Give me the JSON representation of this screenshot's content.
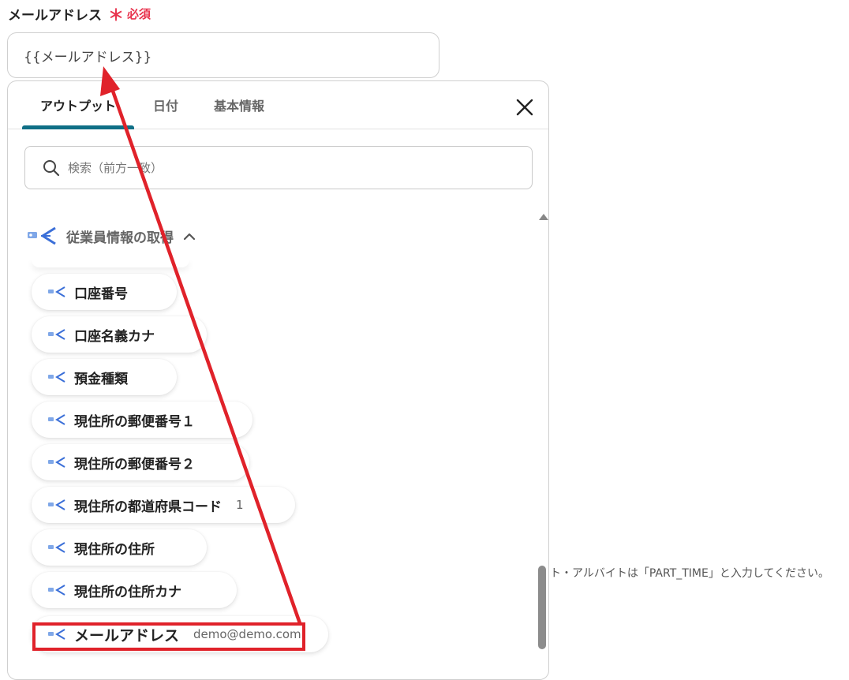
{
  "field": {
    "label": "メールアドレス",
    "required_star": "＊",
    "required_text": "必須",
    "value": "{{メールアドレス}}"
  },
  "panel": {
    "tabs": [
      {
        "label": "アウトプット",
        "active": true
      },
      {
        "label": "日付",
        "active": false
      },
      {
        "label": "基本情報",
        "active": false
      }
    ],
    "search_placeholder": "検索（前方一致）",
    "group_title": "従業員情報の取得",
    "items": [
      {
        "label": "口座番号",
        "sample": ""
      },
      {
        "label": "口座名義カナ",
        "sample": ""
      },
      {
        "label": "預金種類",
        "sample": ""
      },
      {
        "label": "現住所の郵便番号１",
        "sample": ""
      },
      {
        "label": "現住所の郵便番号２",
        "sample": ""
      },
      {
        "label": "現住所の都道府県コード",
        "sample": "1"
      },
      {
        "label": "現住所の住所",
        "sample": ""
      },
      {
        "label": "現住所の住所カナ",
        "sample": ""
      },
      {
        "label": "メールアドレス",
        "sample": "demo@demo.com"
      }
    ]
  },
  "hint": "ト・アルバイトは「PART_TIME」と入力してください。",
  "colors": {
    "accent": "#0f6f86",
    "required": "#e8344e",
    "annotation": "#e0222a",
    "item_icon": "#3b6fd8"
  }
}
